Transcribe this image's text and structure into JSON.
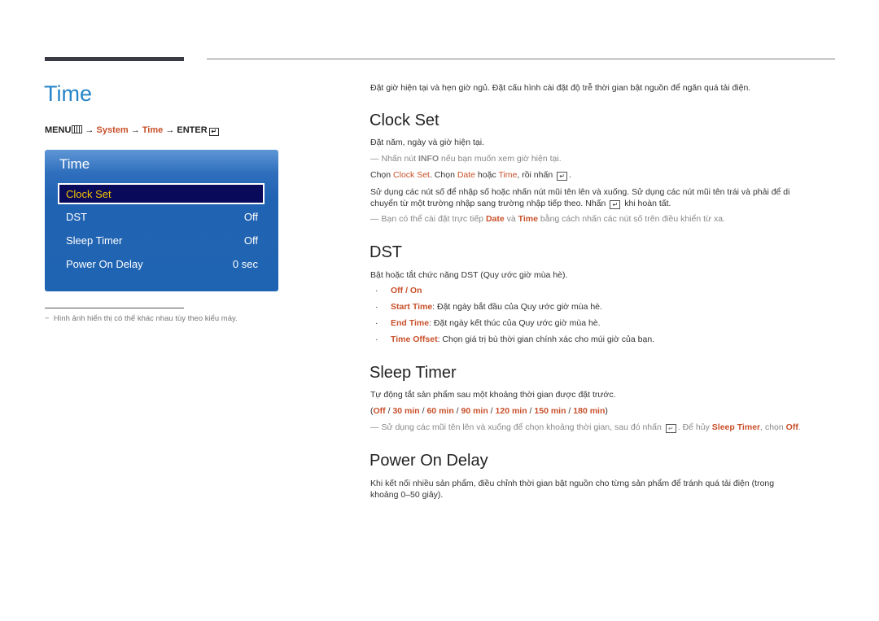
{
  "page_title": "Time",
  "breadcrumb": {
    "menu": "MENU",
    "arrow": "→",
    "system": "System",
    "time": "Time",
    "enter": "ENTER"
  },
  "osd": {
    "title": "Time",
    "items": [
      {
        "label": "Clock Set",
        "value": "",
        "selected": true
      },
      {
        "label": "DST",
        "value": "Off"
      },
      {
        "label": "Sleep Timer",
        "value": "Off"
      },
      {
        "label": "Power On Delay",
        "value": "0 sec"
      }
    ]
  },
  "footnote": "Hình ảnh hiển thị có thể khác nhau tùy theo kiểu máy.",
  "intro": "Đặt giờ hiện tại và hẹn giờ ngủ. Đặt cấu hình cài đặt độ trễ thời gian bật nguồn để ngăn quá tải điện.",
  "clock_set": {
    "heading": "Clock Set",
    "desc": "Đặt năm, ngày và giờ hiện tại.",
    "note1_a": "Nhấn nút ",
    "note1_b": "INFO",
    "note1_c": " nếu bạn muốn xem giờ hiện tại.",
    "step_a": "Chọn ",
    "step_b": "Clock Set",
    "step_c": ". Chọn ",
    "step_d": "Date",
    "step_e": " hoặc ",
    "step_f": "Time",
    "step_g": ", rồi nhấn",
    "step_h": ".",
    "para_line1": "Sử dụng các nút số để nhập số hoặc nhấn nút mũi tên lên và xuống. Sử dụng các nút mũi tên trái và phải để di",
    "para_line2_a": "chuyển từ một trường nhập sang trường nhập tiếp theo. Nhấn",
    "para_line2_b": "khi hoàn tất.",
    "note2_a": "Bạn có thể cài đặt trực tiếp ",
    "note2_b": "Date",
    "note2_c": " và ",
    "note2_d": "Time",
    "note2_e": " bằng cách nhấn các nút số trên điều khiển từ xa."
  },
  "dst": {
    "heading": "DST",
    "desc": "Bật hoặc tắt chức năng DST (Quy ước giờ mùa hè).",
    "bullets": [
      {
        "term": "Off / On",
        "text": ""
      },
      {
        "term": "Start Time",
        "text": ": Đặt ngày bắt đầu của Quy ước giờ mùa hè."
      },
      {
        "term": "End Time",
        "text": ": Đặt ngày kết thúc của Quy ước giờ mùa hè."
      },
      {
        "term": "Time Offset",
        "text": ": Chọn giá trị bù thời gian chính xác cho múi giờ của bạn."
      }
    ]
  },
  "sleep_timer": {
    "heading": "Sleep Timer",
    "desc": "Tự động tắt sản phẩm sau một khoảng thời gian được đặt trước.",
    "options": [
      "Off",
      "30 min",
      "60 min",
      "90 min",
      "120 min",
      "150 min",
      "180 min"
    ],
    "note_a": "Sử dụng các mũi tên lên và xuống để chọn khoảng thời gian, sau đó nhấn",
    "note_b": ". Để hủy ",
    "note_c": "Sleep Timer",
    "note_d": ", chọn ",
    "note_e": "Off",
    "note_f": "."
  },
  "power_on_delay": {
    "heading": "Power On Delay",
    "line1": "Khi kết nối nhiều sản phẩm, điều chỉnh thời gian bật nguồn cho từng sản phẩm để tránh quá tải điện (trong",
    "line2": "khoảng 0–50 giây)."
  },
  "colors": {
    "title_blue": "#2585c8",
    "highlight_orange": "#c8502a",
    "osd_blue": "#2063b3",
    "osd_selected_bg": "#0a0a5a",
    "osd_selected_text": "#f2c200"
  }
}
